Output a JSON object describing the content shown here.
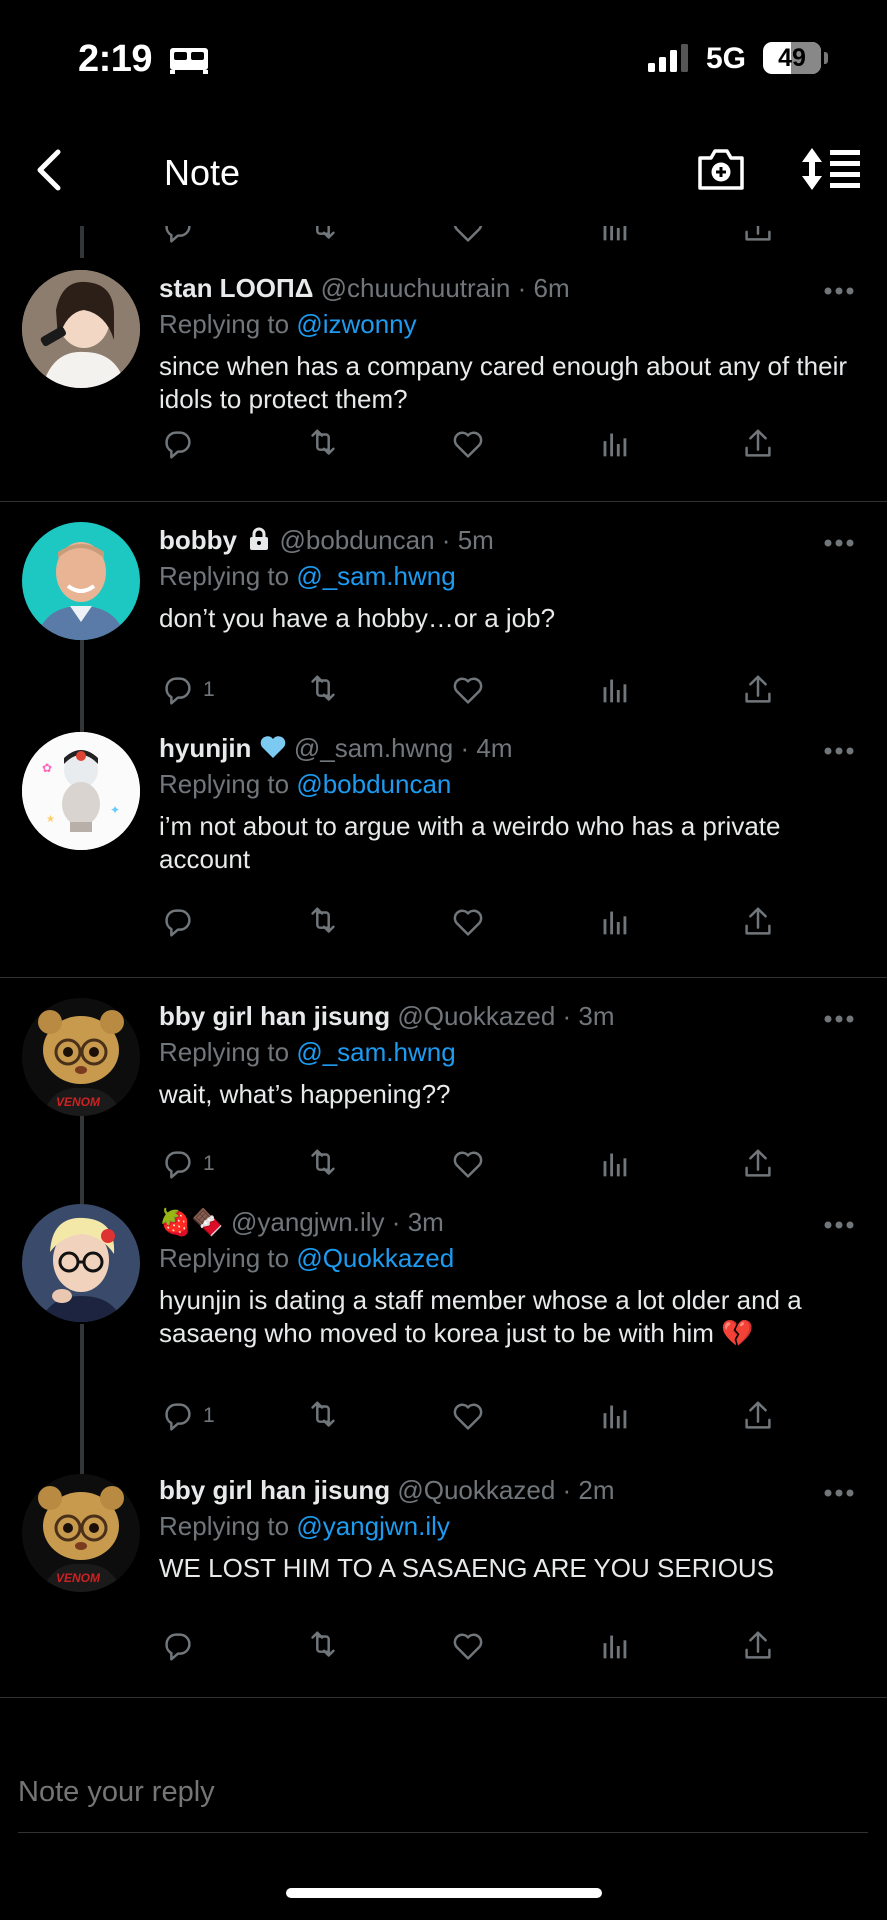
{
  "status_bar": {
    "time": "2:19",
    "network": "5G",
    "battery": "49",
    "battery_level": 0.49,
    "icons": [
      "sleep-bed-icon",
      "signal-bars-icon"
    ]
  },
  "header": {
    "title": "Note",
    "icons": [
      "back-chevron-icon",
      "add-photo-camera-icon",
      "sort-replies-icon"
    ]
  },
  "accent_color": "#1d9bf0",
  "replying_prefix": "Replying to",
  "tweets": [
    {
      "name": "stan LOOПΔ",
      "handle": "@chuuchuutrain",
      "dot": "·",
      "ago": "6m",
      "reply_to": "@izwonny",
      "text": "since when has a company cared enough about any of their idols to protect them?",
      "reply_count": ""
    },
    {
      "name": "bobby",
      "handle": "@bobduncan",
      "dot": "·",
      "ago": "5m",
      "reply_to": "@_sam.hwng",
      "text": "don’t you have a hobby…or a job?",
      "reply_count": "1",
      "badge_icon": "lock-icon"
    },
    {
      "name": "hyunjin",
      "handle": "@_sam.hwng",
      "dot": "·",
      "ago": "4m",
      "reply_to": "@bobduncan",
      "text": "i’m not about to argue with a weirdo who has a private account",
      "reply_count": "",
      "badge_icon": "light-blue-heart-icon"
    },
    {
      "name": "bby girl han jisung",
      "handle": "@Quokkazed",
      "dot": "·",
      "ago": "3m",
      "reply_to": "@_sam.hwng",
      "text": "wait, what’s happening??",
      "reply_count": "1"
    },
    {
      "name": "🍓🍫",
      "handle": "@yangjwn.ily",
      "dot": "·",
      "ago": "3m",
      "reply_to": "@Quokkazed",
      "text": "hyunjin is dating a staff member whose a lot older and a sasaeng who moved to korea just to be with him 💔",
      "reply_count": "1"
    },
    {
      "name": "bby girl han jisung",
      "handle": "@Quokkazed",
      "dot": "·",
      "ago": "2m",
      "reply_to": "@yangjwn.ily",
      "text": "WE LOST HIM TO A SASAENG ARE YOU SERIOUS",
      "reply_count": ""
    }
  ],
  "composer": {
    "placeholder": "Note your reply"
  }
}
